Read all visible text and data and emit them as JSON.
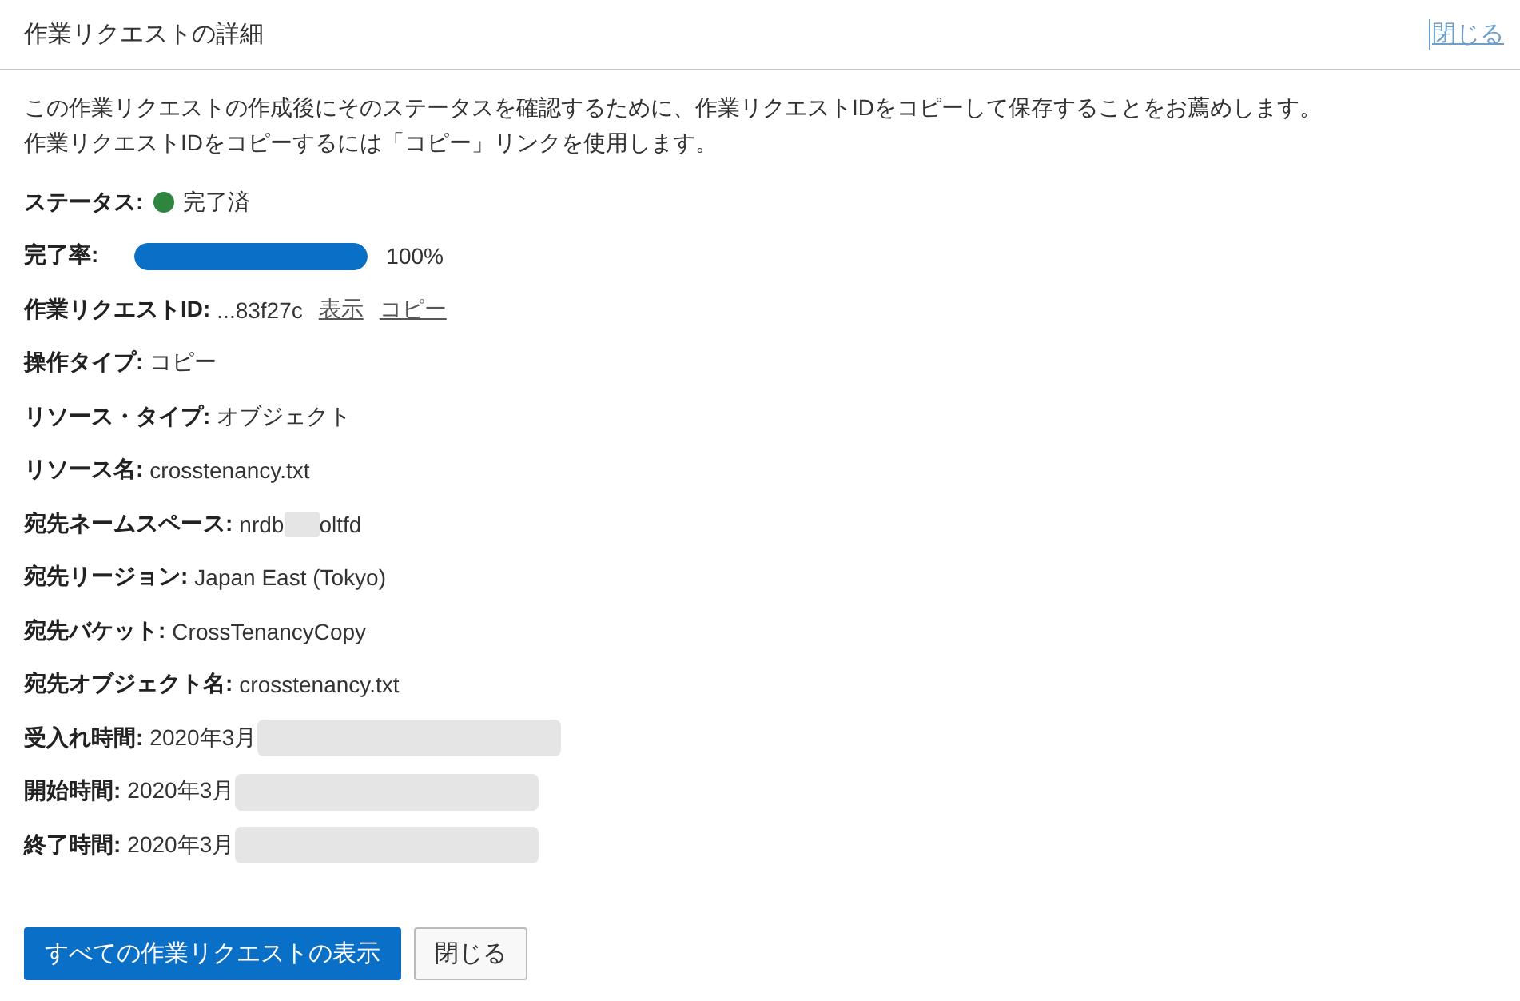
{
  "header": {
    "title": "作業リクエストの詳細",
    "close_link": "閉じる"
  },
  "description": [
    "この作業リクエストの作成後にそのステータスを確認するために、作業リクエストIDをコピーして保存することをお薦めします。",
    "作業リクエストIDをコピーするには「コピー」リンクを使用します。"
  ],
  "fields": [
    {
      "kind": "status",
      "label": "ステータス:",
      "value": "完了済",
      "color": "#2e8540"
    },
    {
      "kind": "progress",
      "label": "完了率:",
      "level": 1,
      "reading": "100%"
    },
    {
      "kind": "id",
      "label": "作業リクエストID:",
      "value": "...83f27c",
      "links": [
        "表示",
        "コピー"
      ]
    },
    {
      "kind": "text",
      "label": "操作タイプ:",
      "value": "コピー"
    },
    {
      "kind": "text",
      "label": "リソース・タイプ:",
      "value": "オブジェクト"
    },
    {
      "kind": "text",
      "label": "リソース名:",
      "value": "crosstenancy.txt"
    },
    {
      "kind": "masked_middle",
      "label": "宛先ネームスペース:",
      "value": "nrdb",
      "value_end": "oltfd"
    },
    {
      "kind": "text",
      "label": "宛先リージョン:",
      "value": "Japan East (Tokyo)"
    },
    {
      "kind": "text",
      "label": "宛先バケット:",
      "value": "CrossTenancyCopy"
    },
    {
      "kind": "text",
      "label": "宛先オブジェクト名:",
      "value": "crosstenancy.txt"
    },
    {
      "kind": "masked_end",
      "label": "受入れ時間:",
      "value": "2020年3月"
    },
    {
      "kind": "masked_end",
      "label": "開始時間:",
      "value": "2020年3月"
    },
    {
      "kind": "masked_end",
      "label": "終了時間:",
      "value": "2020年3月"
    }
  ],
  "buttons": [
    {
      "label": "すべての作業リクエストの表示",
      "primary": true
    },
    {
      "label": "閉じる",
      "primary": false
    }
  ]
}
